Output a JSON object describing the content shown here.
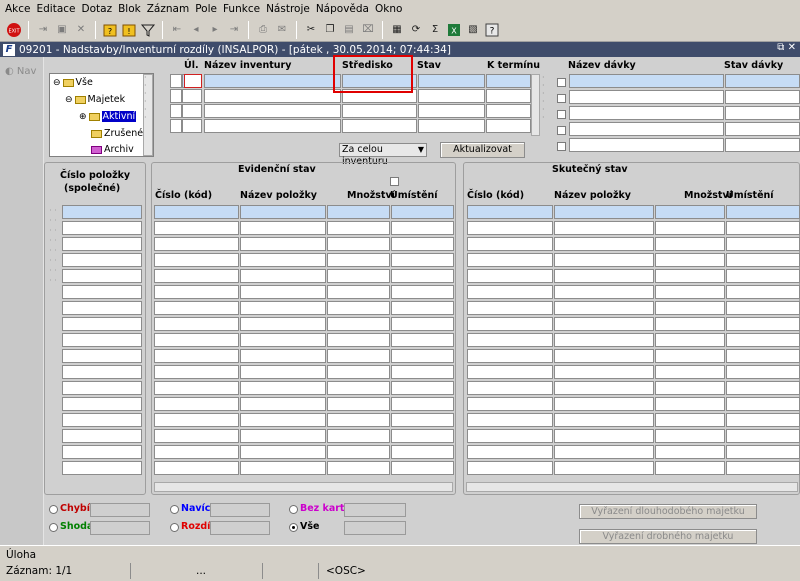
{
  "menu": [
    "Akce",
    "Editace",
    "Dotaz",
    "Blok",
    "Záznam",
    "Pole",
    "Funkce",
    "Nástroje",
    "Nápověda",
    "Okno"
  ],
  "window": {
    "title": "09201 - Nadstavby/Inventurní rozdíly (INSALPOR) - [pátek  , 30.05.2014; 07:44:34]",
    "controls": "⧉ ✕",
    "nav_label": "Nav"
  },
  "tree": {
    "items": [
      {
        "label": "Vše",
        "toggle": "⊖"
      },
      {
        "label": "Majetek",
        "toggle": "⊖"
      },
      {
        "label": "Aktivní",
        "toggle": "⊕"
      },
      {
        "label": "Zrušené",
        "toggle": ""
      },
      {
        "label": "Archiv",
        "toggle": ""
      }
    ]
  },
  "inventory_table": {
    "headers": [
      "Úl.",
      "Název inventury",
      "Středisko",
      "Stav",
      "K termínu"
    ]
  },
  "batch_table": {
    "headers": [
      "Název dávky",
      "Stav dávky"
    ]
  },
  "controls": {
    "scope_select": "Za celou inventuru",
    "update_button": "Aktualizovat"
  },
  "left_panel": {
    "header_line1": "Číslo položky",
    "header_line2": "(společné)"
  },
  "evidence": {
    "title": "Evidenční stav",
    "headers": [
      "Číslo (kód)",
      "Název položky",
      "Množství",
      "Umístění"
    ]
  },
  "actual": {
    "title": "Skutečný stav",
    "headers": [
      "Číslo (kód)",
      "Název položky",
      "Množství",
      "Umístění"
    ]
  },
  "filters": {
    "chybi": "Chybí",
    "shoda": "Shoda",
    "navic": "Navíc",
    "rozdil": "Rozdíl",
    "bez_karty": "Bez karty",
    "vse": "Vše",
    "selected": "Vše",
    "colors": {
      "chybi": "#c00000",
      "shoda": "#008000",
      "navic": "#0000ff",
      "rozdil": "#e00000",
      "bez_karty": "#cc00cc"
    }
  },
  "buttons": {
    "long_term": "Vyřazení dlouhodobého majetku",
    "small": "Vyřazení drobného majetku"
  },
  "status": {
    "line1": "Úloha",
    "record": "Záznam: 1/1",
    "seg2": "...",
    "seg3": "<OSC>"
  },
  "toolbar_icons": [
    "exit-icon",
    "save-icon",
    "print-icon",
    "delete-icon",
    "query-icon",
    "execute-icon",
    "filter-icon",
    "first-icon",
    "prev-icon",
    "print-icon",
    "mail-icon",
    "cut-icon",
    "copy-icon",
    "paste-icon",
    "grid-icon",
    "reload-icon",
    "sum-icon",
    "excel-icon",
    "help-icon"
  ]
}
